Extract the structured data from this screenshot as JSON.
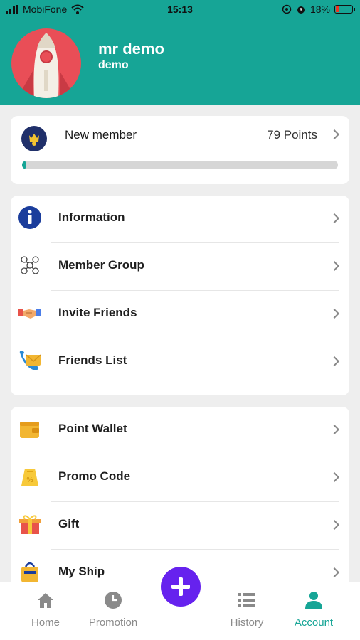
{
  "status_bar": {
    "carrier": "MobiFone",
    "time": "15:13",
    "battery": "18%"
  },
  "profile": {
    "name": "mr demo",
    "username": "demo"
  },
  "membership": {
    "level": "New member",
    "points": "79 Points",
    "progress_fraction": 0.01
  },
  "menu_group_1": [
    {
      "label": "Information",
      "icon": "info-icon"
    },
    {
      "label": "Member Group",
      "icon": "member-group-icon"
    },
    {
      "label": "Invite Friends",
      "icon": "handshake-icon"
    },
    {
      "label": "Friends List",
      "icon": "contacts-icon"
    }
  ],
  "menu_group_2": [
    {
      "label": "Point Wallet",
      "icon": "wallet-icon"
    },
    {
      "label": "Promo Code",
      "icon": "promo-tag-icon"
    },
    {
      "label": "Gift",
      "icon": "gift-icon"
    },
    {
      "label": "My Ship",
      "icon": "ship-bag-icon"
    }
  ],
  "bottom_nav": [
    {
      "label": "Home",
      "icon": "home-icon"
    },
    {
      "label": "Promotion",
      "icon": "clock-icon"
    },
    {
      "label": "History",
      "icon": "list-icon"
    },
    {
      "label": "Account",
      "icon": "person-icon",
      "active": true
    }
  ],
  "colors": {
    "primary": "#16a596",
    "fab": "#6622ee",
    "avatar_bg": "#e94e57"
  }
}
